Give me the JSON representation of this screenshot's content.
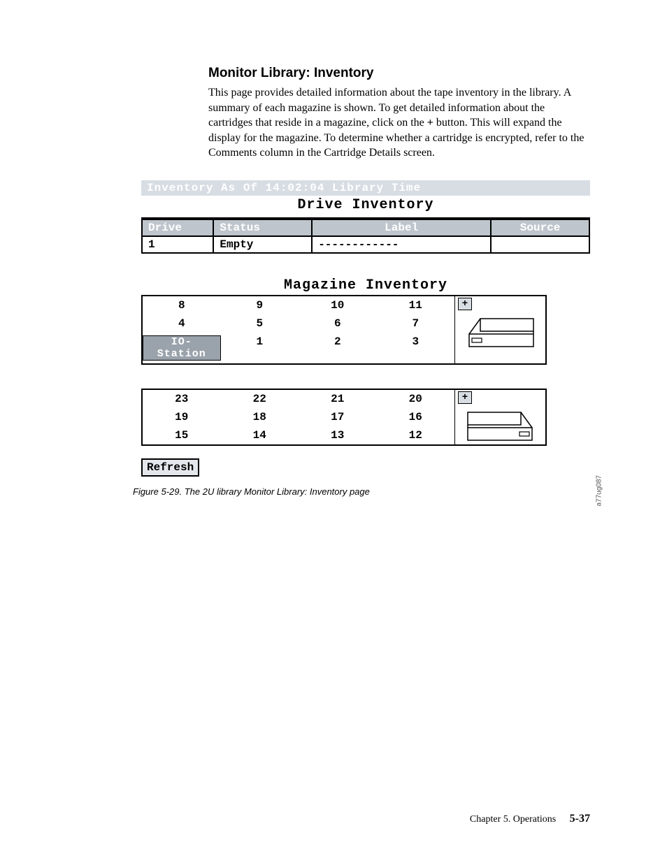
{
  "heading": "Monitor Library: Inventory",
  "paragraph_pre": "This page provides detailed information about the tape inventory in the library. A summary of each magazine is shown. To get detailed information about the cartridges that reside in a magazine, click on the ",
  "paragraph_plus": "+",
  "paragraph_post": " button. This will expand the display for the magazine. To determine whether a cartridge is encrypted, refer to the Comments column in the Cartridge Details screen.",
  "banner": "Inventory As Of 14:02:04 Library Time",
  "drive_title": "Drive Inventory",
  "drive_headers": {
    "c0": "Drive",
    "c1": "Status",
    "c2": "Label",
    "c3": "Source"
  },
  "drive_row": {
    "c0": "1",
    "c1": "Empty",
    "c2": "------------",
    "c3": ""
  },
  "mag_title": "Magazine Inventory",
  "mag1": {
    "r0": {
      "c0": "8",
      "c1": "9",
      "c2": "10",
      "c3": "11"
    },
    "r1": {
      "c0": "4",
      "c1": "5",
      "c2": "6",
      "c3": "7"
    },
    "r2": {
      "io": "IO-Station",
      "c1": "1",
      "c2": "2",
      "c3": "3"
    }
  },
  "mag2": {
    "r0": {
      "c0": "23",
      "c1": "22",
      "c2": "21",
      "c3": "20"
    },
    "r1": {
      "c0": "19",
      "c1": "18",
      "c2": "17",
      "c3": "16"
    },
    "r2": {
      "c0": "15",
      "c1": "14",
      "c2": "13",
      "c3": "12"
    }
  },
  "expand_label": "+",
  "refresh_label": "Refresh",
  "side_label": "a77ug087",
  "caption": "Figure 5-29. The 2U library Monitor Library: Inventory page",
  "footer_chapter": "Chapter 5. Operations",
  "footer_page": "5-37"
}
